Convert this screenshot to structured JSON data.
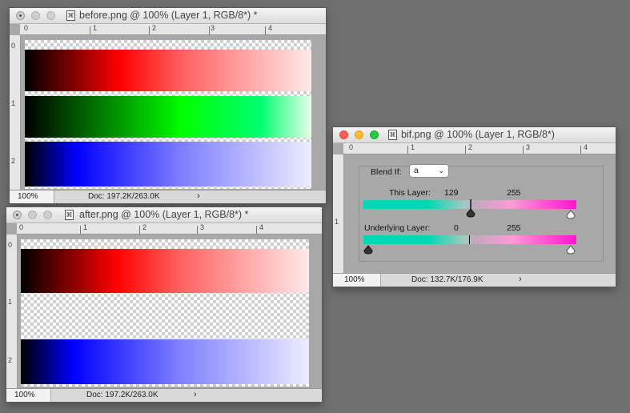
{
  "windows": {
    "before": {
      "title": "before.png @ 100% (Layer 1, RGB/8*) *",
      "zoom": "100%",
      "doc": "Doc: 197.2K/263.0K",
      "ruler_top": [
        "0",
        "1",
        "2",
        "3",
        "4"
      ],
      "ruler_left": [
        "0",
        "1",
        "2"
      ],
      "bands": [
        "red",
        "green",
        "blue"
      ]
    },
    "after": {
      "title": "after.png @ 100% (Layer 1, RGB/8*) *",
      "zoom": "100%",
      "doc": "Doc: 197.2K/263.0K",
      "ruler_top": [
        "0",
        "1",
        "2",
        "3",
        "4"
      ],
      "ruler_left": [
        "0",
        "1",
        "2"
      ],
      "bands": [
        "red",
        "transparent",
        "blue"
      ]
    },
    "bif": {
      "title": "bif.png @ 100% (Layer 1, RGB/8*)",
      "zoom": "100%",
      "doc": "Doc: 132.7K/176.9K",
      "ruler_top": [
        "0",
        "1",
        "2",
        "3",
        "4"
      ],
      "ruler_left": [
        "1"
      ],
      "blend_if_label": "Blend If:",
      "blend_if_value": "a",
      "this_layer_label": "This Layer:",
      "this_layer_low": "129",
      "this_layer_high": "255",
      "underlying_label": "Underlying Layer:",
      "underlying_low": "0",
      "underlying_high": "255"
    }
  },
  "colors": {
    "red": "#ff0000",
    "green": "#00ff00",
    "blue": "#0000ff",
    "blend_teal": "#00d7b4",
    "blend_magenta": "#ff14d2"
  },
  "icons": {
    "doc": "document-icon",
    "select_arrow": "chevron-down-icon",
    "status_arrow": "chevron-right-icon"
  }
}
